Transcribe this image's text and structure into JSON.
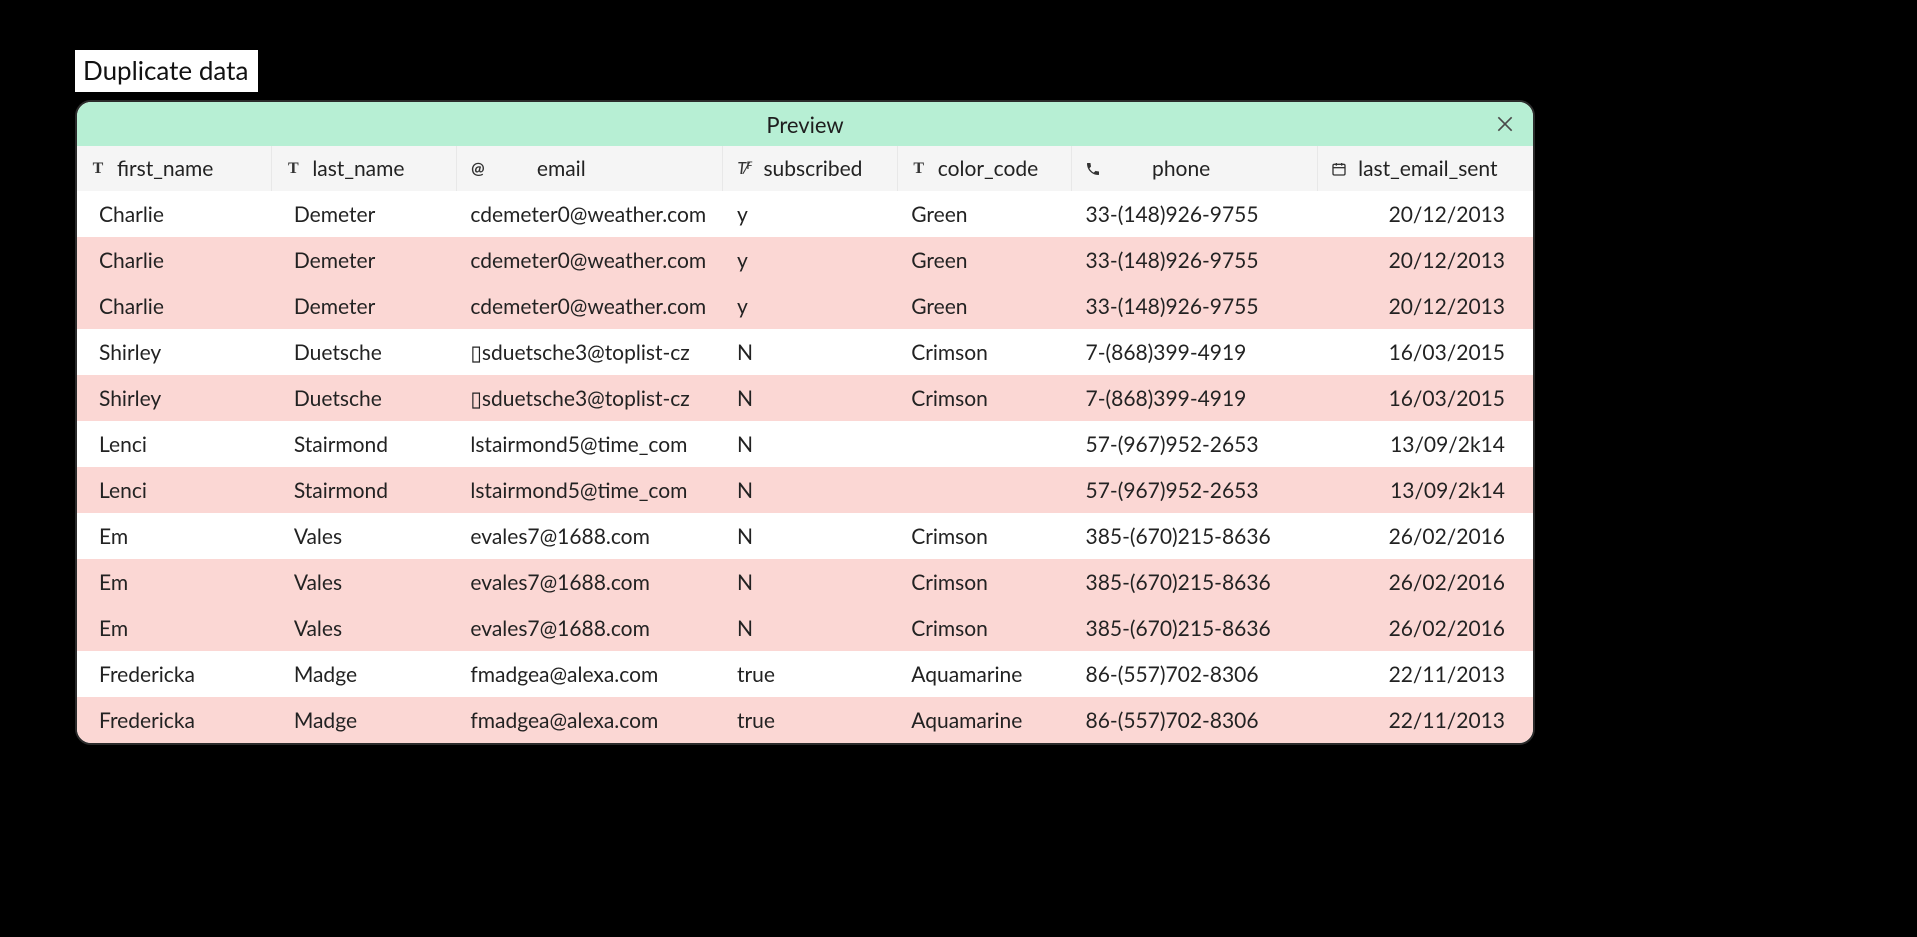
{
  "title": "Duplicate data",
  "panel": {
    "header": "Preview",
    "close_icon": "close-icon"
  },
  "columns": [
    {
      "key": "first_name",
      "label": "first_name",
      "icon": "text"
    },
    {
      "key": "last_name",
      "label": "last_name",
      "icon": "text"
    },
    {
      "key": "email",
      "label": "email",
      "icon": "at"
    },
    {
      "key": "subscribed",
      "label": "subscribed",
      "icon": "bool"
    },
    {
      "key": "color_code",
      "label": "color_code",
      "icon": "text"
    },
    {
      "key": "phone",
      "label": "phone",
      "icon": "phone"
    },
    {
      "key": "last_email_sent",
      "label": "last_email_sent",
      "icon": "date"
    }
  ],
  "rows": [
    {
      "dup": false,
      "first_name": "Charlie",
      "last_name": "Demeter",
      "email": "cdemeter0@weather.com",
      "subscribed": "y",
      "color_code": "Green",
      "phone": "33-(148)926-9755",
      "last_email_sent": "20/12/2013"
    },
    {
      "dup": true,
      "first_name": "Charlie",
      "last_name": "Demeter",
      "email": "cdemeter0@weather.com",
      "subscribed": "y",
      "color_code": "Green",
      "phone": "33-(148)926-9755",
      "last_email_sent": "20/12/2013"
    },
    {
      "dup": true,
      "first_name": "Charlie",
      "last_name": "Demeter",
      "email": "cdemeter0@weather.com",
      "subscribed": "y",
      "color_code": "Green",
      "phone": "33-(148)926-9755",
      "last_email_sent": "20/12/2013"
    },
    {
      "dup": false,
      "first_name": "Shirley",
      "last_name": "Duetsche",
      "email": "▯sduetsche3@toplist-cz",
      "subscribed": "N",
      "color_code": "Crimson",
      "phone": "7-(868)399-4919",
      "last_email_sent": "16/03/2015"
    },
    {
      "dup": true,
      "first_name": "Shirley",
      "last_name": "Duetsche",
      "email": "▯sduetsche3@toplist-cz",
      "subscribed": "N",
      "color_code": "Crimson",
      "phone": "7-(868)399-4919",
      "last_email_sent": "16/03/2015"
    },
    {
      "dup": false,
      "first_name": "Lenci",
      "last_name": "Stairmond",
      "email": "lstairmond5@time_com",
      "subscribed": "N",
      "color_code": "",
      "phone": "57-(967)952-2653",
      "last_email_sent": "13/09/2k14"
    },
    {
      "dup": true,
      "first_name": "Lenci",
      "last_name": "Stairmond",
      "email": "lstairmond5@time_com",
      "subscribed": "N",
      "color_code": "",
      "phone": "57-(967)952-2653",
      "last_email_sent": "13/09/2k14"
    },
    {
      "dup": false,
      "first_name": "Em",
      "last_name": "Vales",
      "email": "evales7@1688.com",
      "subscribed": "N",
      "color_code": "Crimson",
      "phone": "385-(670)215-8636",
      "last_email_sent": "26/02/2016"
    },
    {
      "dup": true,
      "first_name": "Em",
      "last_name": "Vales",
      "email": "evales7@1688.com",
      "subscribed": "N",
      "color_code": "Crimson",
      "phone": "385-(670)215-8636",
      "last_email_sent": "26/02/2016"
    },
    {
      "dup": true,
      "first_name": "Em",
      "last_name": "Vales",
      "email": "evales7@1688.com",
      "subscribed": "N",
      "color_code": "Crimson",
      "phone": "385-(670)215-8636",
      "last_email_sent": "26/02/2016"
    },
    {
      "dup": false,
      "first_name": "Fredericka",
      "last_name": "Madge",
      "email": "fmadgea@alexa.com",
      "subscribed": "true",
      "color_code": "Aquamarine",
      "phone": "86-(557)702-8306",
      "last_email_sent": "22/11/2013"
    },
    {
      "dup": true,
      "first_name": "Fredericka",
      "last_name": "Madge",
      "email": "fmadgea@alexa.com",
      "subscribed": "true",
      "color_code": "Aquamarine",
      "phone": "86-(557)702-8306",
      "last_email_sent": "22/11/2013"
    }
  ]
}
